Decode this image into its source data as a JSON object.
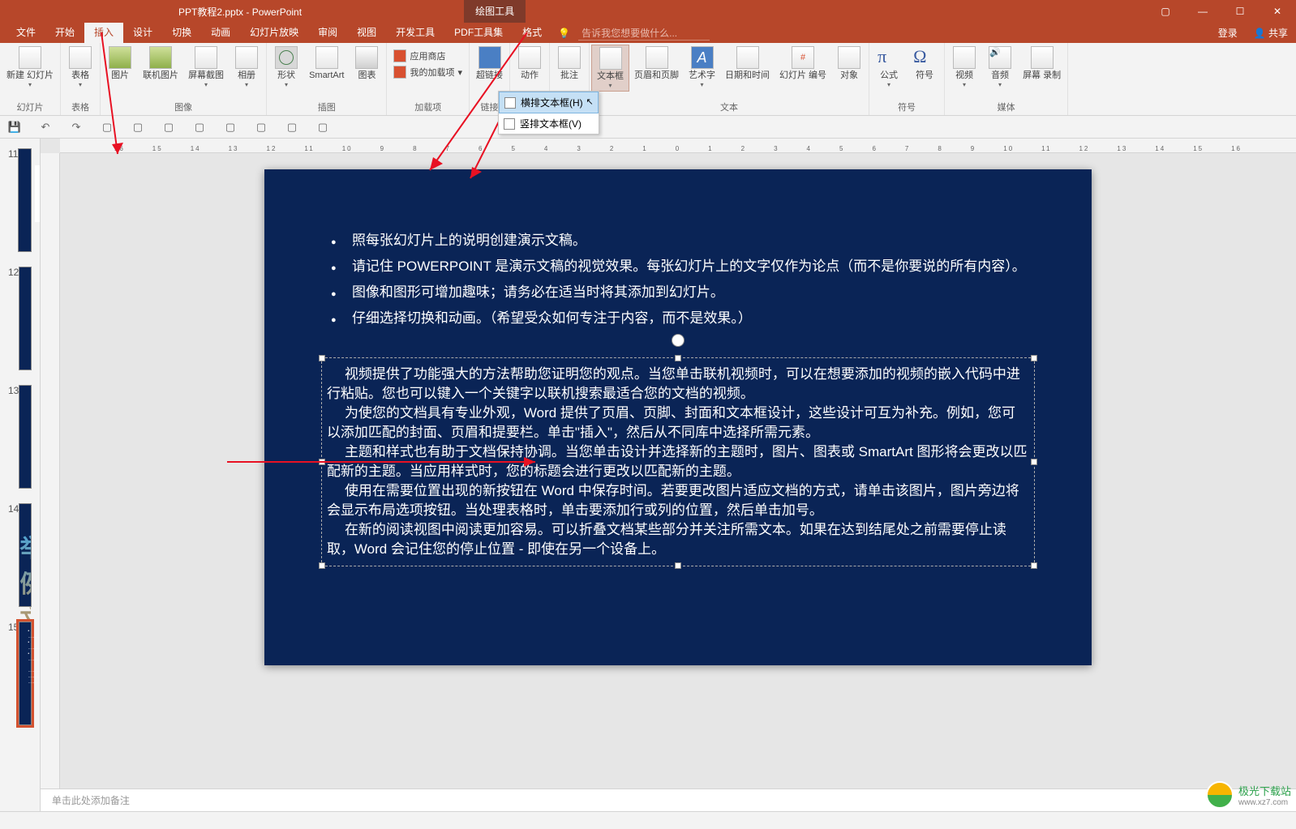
{
  "title": "PPT教程2.pptx - PowerPoint",
  "tool_tab": "绘图工具",
  "tabs": {
    "file": "文件",
    "home": "开始",
    "insert": "插入",
    "design": "设计",
    "transition": "切换",
    "animation": "动画",
    "slideshow": "幻灯片放映",
    "review": "审阅",
    "view": "视图",
    "developer": "开发工具",
    "pdf": "PDF工具集",
    "format": "格式"
  },
  "tell_me": "告诉我您想要做什么...",
  "account": {
    "login": "登录",
    "share": "共享"
  },
  "ribbon": {
    "groups": {
      "slides": "幻灯片",
      "tables": "表格",
      "images": "图像",
      "illustrations": "插图",
      "addins": "加载项",
      "links": "链接",
      "action": "动作",
      "comments": "批注",
      "text": "文本",
      "symbols": "符号",
      "media": "媒体"
    },
    "btn": {
      "new_slide": "新建\n幻灯片",
      "table": "表格",
      "picture": "图片",
      "online_pic": "联机图片",
      "screenshot": "屏幕截图",
      "album": "相册",
      "shapes": "形状",
      "smartart": "SmartArt",
      "chart": "图表",
      "store": "应用商店",
      "my_addins": "我的加载项",
      "hyperlink": "超链接",
      "action": "动作",
      "comment": "批注",
      "textbox": "文本框",
      "header": "页眉和页脚",
      "wordart": "艺术字",
      "datetime": "日期和时间",
      "slide_num": "幻灯片\n编号",
      "object": "对象",
      "equation": "公式",
      "symbol": "符号",
      "video": "视频",
      "audio": "音频",
      "screen_rec": "屏幕\n录制"
    }
  },
  "dropdown": {
    "horizontal": "横排文本框(H)",
    "vertical": "竖排文本框(V)"
  },
  "thumbs": {
    "n11": "11",
    "n12": "12",
    "n13": "13",
    "n14": "14",
    "n15": "15",
    "bigtxt": "举例文字"
  },
  "slide": {
    "b1": "照每张幻灯片上的说明创建演示文稿。",
    "b2": "请记住 POWERPOINT 是演示文稿的视觉效果。每张幻灯片上的文字仅作为论点（而不是你要说的所有内容）。",
    "b3": "图像和图形可增加趣味；请务必在适当时将其添加到幻灯片。",
    "b4": "仔细选择切换和动画。（希望受众如何专注于内容，而不是效果。）",
    "p1": "视频提供了功能强大的方法帮助您证明您的观点。当您单击联机视频时，可以在想要添加的视频的嵌入代码中进行粘贴。您也可以键入一个关键字以联机搜索最适合您的文档的视频。",
    "p2": "为使您的文档具有专业外观，Word 提供了页眉、页脚、封面和文本框设计，这些设计可互为补充。例如，您可以添加匹配的封面、页眉和提要栏。单击\"插入\"，然后从不同库中选择所需元素。",
    "p3": "主题和样式也有助于文档保持协调。当您单击设计并选择新的主题时，图片、图表或 SmartArt 图形将会更改以匹配新的主题。当应用样式时，您的标题会进行更改以匹配新的主题。",
    "p4": "使用在需要位置出现的新按钮在 Word 中保存时间。若要更改图片适应文档的方式，请单击该图片，图片旁边将会显示布局选项按钮。当处理表格时，单击要添加行或列的位置，然后单击加号。",
    "p5": "在新的阅读视图中阅读更加容易。可以折叠文档某些部分并关注所需文本。如果在达到结尾处之前需要停止读取，Word 会记住您的停止位置 - 即使在另一个设备上。"
  },
  "notes": "单击此处添加备注",
  "watermark": {
    "name": "极光下载站",
    "url": "www.xz7.com"
  }
}
